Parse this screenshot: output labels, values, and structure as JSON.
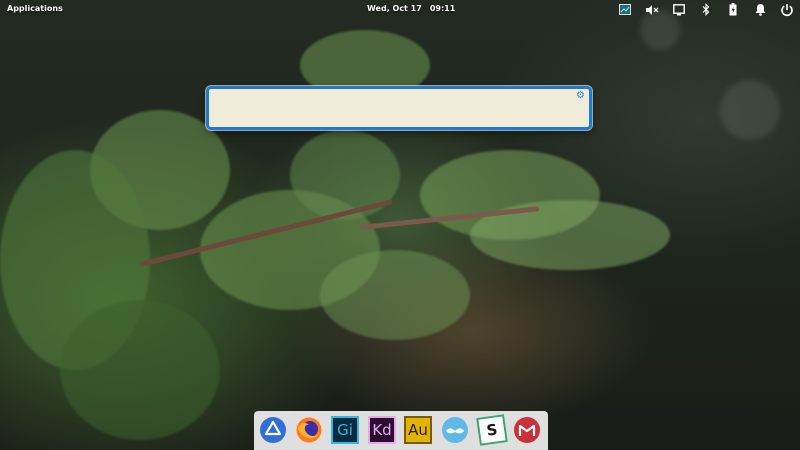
{
  "panel": {
    "applications_label": "Applications",
    "date": "Wed, Oct 17",
    "time": "09:11",
    "indicators": [
      {
        "name": "monitor-icon"
      },
      {
        "name": "sound-muted-icon"
      },
      {
        "name": "network-icon"
      },
      {
        "name": "bluetooth-icon"
      },
      {
        "name": "battery-icon"
      },
      {
        "name": "notification-bell-icon"
      },
      {
        "name": "power-icon"
      }
    ]
  },
  "entry": {
    "value": "",
    "placeholder": "",
    "settings_icon": "gear-icon"
  },
  "dock": {
    "items": [
      {
        "name": "google-drive",
        "icon": "drive-icon"
      },
      {
        "name": "firefox",
        "icon": "firefox-icon"
      },
      {
        "name": "gimp",
        "icon": "gi-icon",
        "label": "Gi",
        "color": "#31b6e8",
        "bg": "#0c2a3d"
      },
      {
        "name": "kdenlive",
        "icon": "kd-icon",
        "label": "Kd",
        "color": "#e8a8e8",
        "bg": "#2a0f33"
      },
      {
        "name": "audacity",
        "icon": "au-icon",
        "label": "Au",
        "color": "#2a1a00",
        "bg": "#e0b400"
      },
      {
        "name": "mustache-app",
        "icon": "mustache-icon"
      },
      {
        "name": "slack",
        "icon": "slack-icon",
        "label": "S"
      },
      {
        "name": "mail-app",
        "icon": "mail-icon"
      }
    ]
  },
  "colors": {
    "accent": "#1e7bd0",
    "entry_bg": "#f1ebd9",
    "dock_bg": "#f0f0f0"
  }
}
